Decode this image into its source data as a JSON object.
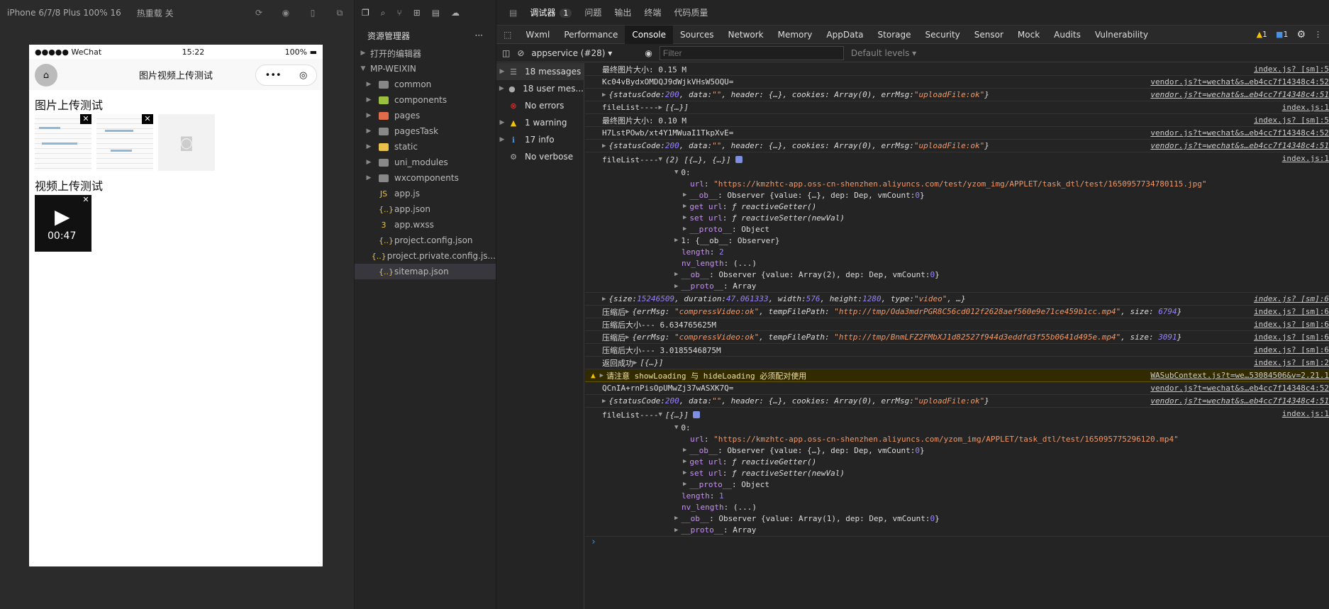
{
  "simulator": {
    "device": "iPhone 6/7/8 Plus 100% 16",
    "hotreload": "热重载 关",
    "status": {
      "carrier": "●●●●● WeChat",
      "time": "15:22",
      "battery": "100%"
    },
    "nav_title": "图片视频上传测试",
    "image_section": "图片上传测试",
    "video_section": "视频上传测试",
    "video_duration": "00:47"
  },
  "explorer": {
    "title": "资源管理器",
    "open_editors": "打开的编辑器",
    "project": "MP-WEIXIN",
    "items": [
      {
        "label": "common",
        "type": "folder",
        "color": "#888"
      },
      {
        "label": "components",
        "type": "folder",
        "color": "#9bbf3e"
      },
      {
        "label": "pages",
        "type": "folder",
        "color": "#e06c4b"
      },
      {
        "label": "pagesTask",
        "type": "folder",
        "color": "#888"
      },
      {
        "label": "static",
        "type": "folder",
        "color": "#e8c14b"
      },
      {
        "label": "uni_modules",
        "type": "folder",
        "color": "#888"
      },
      {
        "label": "wxcomponents",
        "type": "folder",
        "color": "#888"
      },
      {
        "label": "app.js",
        "type": "file",
        "icon": "JS"
      },
      {
        "label": "app.json",
        "type": "file",
        "icon": "{..}"
      },
      {
        "label": "app.wxss",
        "type": "file",
        "icon": "3"
      },
      {
        "label": "project.config.json",
        "type": "file",
        "icon": "{..}"
      },
      {
        "label": "project.private.config.js...",
        "type": "file",
        "icon": "{..}"
      },
      {
        "label": "sitemap.json",
        "type": "file",
        "icon": "{..}"
      }
    ]
  },
  "devtools": {
    "top_tabs": {
      "debugger": "调试器",
      "debugger_count": "1",
      "problems": "问题",
      "output": "输出",
      "terminal": "终端",
      "quality": "代码质量"
    },
    "panels": [
      "Wxml",
      "Performance",
      "Console",
      "Sources",
      "Network",
      "Memory",
      "AppData",
      "Storage",
      "Security",
      "Sensor",
      "Mock",
      "Audits",
      "Vulnerability"
    ],
    "warn_count": "1",
    "msg_count": "1",
    "context": "appservice (#28)",
    "filter_placeholder": "Filter",
    "levels": "Default levels",
    "sidebar": [
      {
        "label": "18 messages",
        "icon": "list"
      },
      {
        "label": "18 user mes...",
        "icon": "user"
      },
      {
        "label": "No errors",
        "icon": "error"
      },
      {
        "label": "1 warning",
        "icon": "warning"
      },
      {
        "label": "17 info",
        "icon": "info"
      },
      {
        "label": "No verbose",
        "icon": "verbose"
      }
    ]
  },
  "console": {
    "l1": "最终图片大小:  0.15 M",
    "l1s": "index.js? [sm]:5",
    "l2": "Kc04vBydxOMDQJ9dWjkVHsW5OQU=",
    "l2s": "vendor.js?t=wechat&s…eb4cc7f14348c4:52",
    "l3a": "{statusCode: ",
    "l3b": "200",
    "l3c": ", data: ",
    "l3d": "\"\"",
    "l3e": ", header: {…}, cookies: Array(0), errMsg: ",
    "l3f": "\"uploadFile:ok\"",
    "l3g": "}",
    "l3s": "vendor.js?t=wechat&s…eb4cc7f14348c4:51",
    "l4": "fileList---- ",
    "l4b": "[{…}]",
    "l4s": "index.js:1",
    "l5": "最终图片大小:  0.10 M",
    "l5s": "index.js? [sm]:5",
    "l6": "H7LstPOwb/xt4Y1MWuaI1TkpXvE=",
    "l6s": "vendor.js?t=wechat&s…eb4cc7f14348c4:52",
    "l7s": "vendor.js?t=wechat&s…eb4cc7f14348c4:51",
    "l8": "fileList---- ",
    "l8b": "(2) [{…}, {…}]",
    "l8s": "index.js:1",
    "url1": "\"https://kmzhtc-app.oss-cn-shenzhen.aliyuncs.com/test/yzom_img/APPLET/task_dtl/test/1650957734780115.jpg\"",
    "ob": "Observer {value: {…}, dep: Dep, vmCount: ",
    "zero": "0",
    "close": "}",
    "getu": "get url",
    "setu": "set url",
    "fn": "ƒ",
    "react_get": "reactiveGetter()",
    "react_set": "reactiveSetter(newVal)",
    "proto": "__proto__",
    "object": "Object",
    "array": "Array",
    "i1": "1: {__ob__: Observer}",
    "length": "length",
    "len2": "2",
    "len1": "1",
    "nvlen": "nv_length",
    "nvv": "(...)",
    "obarr2": "Observer {value: Array(2), dep: Dep, vmCount: ",
    "obarr1": "Observer {value: Array(1), dep: Dep, vmCount: ",
    "v1": "{size: ",
    "v1n": "15246509",
    "v1b": ", duration: ",
    "v1d": "47.061333",
    "v1c": ", width: ",
    "v1w": "576",
    "v1e": ", height: ",
    "v1h": "1280",
    "v1f": ", type: ",
    "v1t": "\"video\"",
    "v1g": ", …}",
    "v1s": "index.js? [sm]:6",
    "c1": "压缩后 ",
    "c1a": "{errMsg: ",
    "c1b": "\"compressVideo:ok\"",
    "c1c": ", tempFilePath: ",
    "c1d": "\"http://tmp/Oda3mdrPGR8C56cd012f2628aef560e9e71ce459b1cc.mp4\"",
    "c1e": ", size: ",
    "c1f": "6794",
    "c1g": "}",
    "c1s": "index.js? [sm]:6",
    "c2": "压缩后大小--- 6.634765625M",
    "c2s": "index.js? [sm]:6",
    "c3d": "\"http://tmp/BnmLFZ2FMbXJ1d82527f944d3eddfd3f55b0641d495e.mp4\"",
    "c3f": "3091",
    "c3s": "index.js? [sm]:6",
    "c4": "压缩后大小--- 3.0185546875M",
    "c4s": "index.js? [sm]:6",
    "r1": "返回成功 ",
    "r1b": "[{…}]",
    "r1s": "index.js? [sm]:2",
    "w1": "请注意 showLoading 与 hideLoading 必须配对使用",
    "w1s": "WASubContext.js?t=we…53084506&v=2.21.1",
    "l9": "QCnIA+rnPisOpUMwZj37wASXK7Q=",
    "l9s": "vendor.js?t=wechat&s…eb4cc7f14348c4:52",
    "l10s": "vendor.js?t=wechat&s…eb4cc7f14348c4:51",
    "l11": "fileList---- ",
    "l11b": "[{…}]",
    "l11s": "index.js:1",
    "url2": "\"https://kmzhtc-app.oss-cn-shenzhen.aliyuncs.com/yzom_img/APPLET/task_dtl/test/165095775296120.mp4\"",
    "url_key": "url",
    "idx0": "0:",
    "obkey": "__ob__"
  },
  "colors": {
    "accent": "#4a90e2",
    "warning": "#f5c400",
    "error": "#e53935"
  }
}
